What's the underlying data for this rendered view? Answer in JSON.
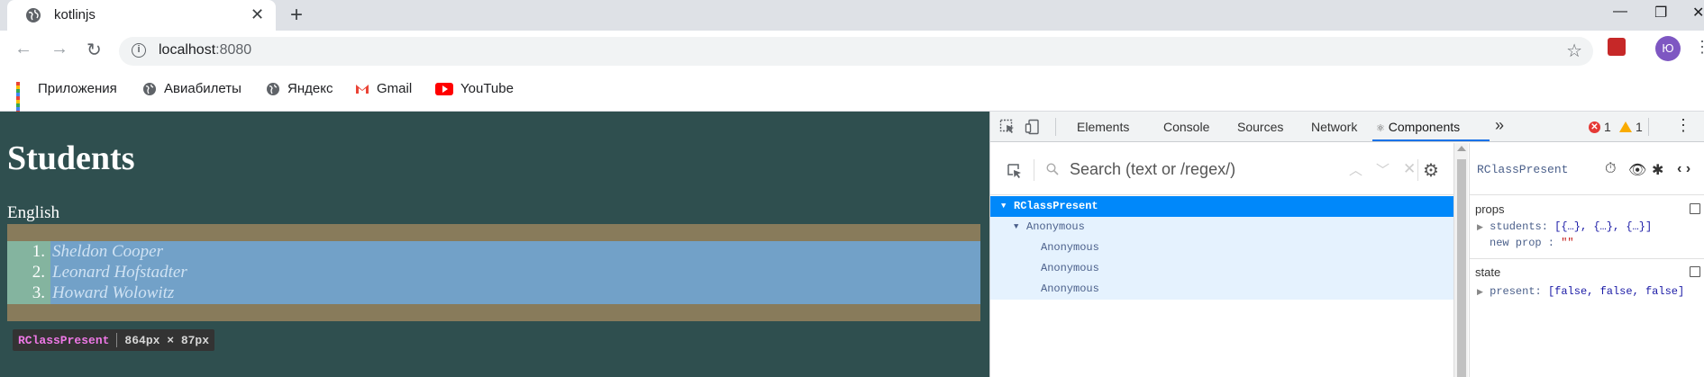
{
  "browser": {
    "tab_title": "kotlinjs",
    "new_tab": "+",
    "tab_close": "✕",
    "url_host": "localhost",
    "url_port": ":8080",
    "avatar_letter": "Ю",
    "min": "—",
    "restore": "❐",
    "close": "✕"
  },
  "bookmarks": [
    {
      "label": "Приложения",
      "icon": "apps-grid-icon"
    },
    {
      "label": "Авиабилеты",
      "icon": "globe-icon"
    },
    {
      "label": "Яндекс",
      "icon": "globe-icon"
    },
    {
      "label": "Gmail",
      "icon": "gmail-icon"
    },
    {
      "label": "YouTube",
      "icon": "youtube-icon"
    }
  ],
  "page": {
    "title": "Students",
    "subject": "English",
    "students": [
      {
        "num": "1.",
        "name": "Sheldon Cooper"
      },
      {
        "num": "2.",
        "name": "Leonard Hofstadter"
      },
      {
        "num": "3.",
        "name": "Howard Wolowitz"
      }
    ],
    "tooltip": {
      "component": "RClassPresent",
      "dims": "864px × 87px"
    }
  },
  "devtools": {
    "tabs": [
      "Elements",
      "Console",
      "Sources",
      "Network",
      "Components"
    ],
    "active_tab": "Components",
    "components_prefix": "⚛",
    "more": "»",
    "errors": "1",
    "warnings": "1",
    "search_placeholder": "Search (text or /regex/)",
    "tree": [
      {
        "label": "RClassPresent",
        "depth": 0,
        "selected": true,
        "caret": "▼"
      },
      {
        "label": "Anonymous",
        "depth": 1,
        "selected": false,
        "caret": "▼"
      },
      {
        "label": "Anonymous",
        "depth": 2,
        "selected": false,
        "caret": ""
      },
      {
        "label": "Anonymous",
        "depth": 2,
        "selected": false,
        "caret": ""
      },
      {
        "label": "Anonymous",
        "depth": 2,
        "selected": false,
        "caret": ""
      }
    ],
    "inspector": {
      "component": "RClassPresent",
      "props_title": "props",
      "props": {
        "students_key": "students",
        "students_value": "[{…}, {…}, {…}]",
        "newprop_key": "new prop",
        "newprop_value": "\"\""
      },
      "state_title": "state",
      "state": {
        "present_key": "present",
        "present_value": "[false, false, false]"
      }
    }
  },
  "colors": {
    "page_bg": "#2f4f4f",
    "selected_row": "#0088fa",
    "tree_row_bg": "#e5f2fe",
    "active_tab_underline": "#1a73e8"
  }
}
